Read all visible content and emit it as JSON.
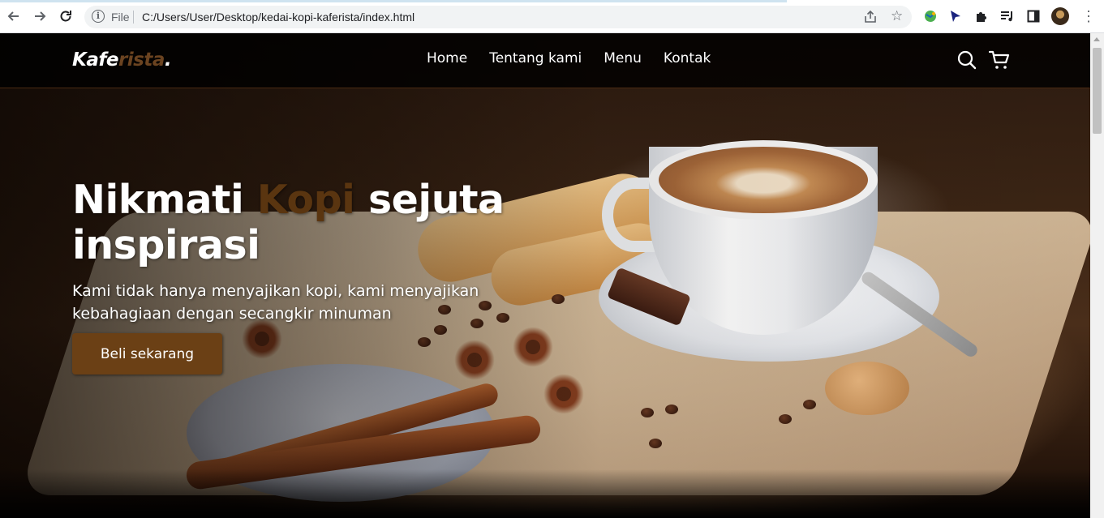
{
  "browser": {
    "file_label": "File",
    "url": "C:/Users/User/Desktop/kedai-kopi-kaferista/index.html",
    "icons": [
      "back-icon",
      "forward-icon",
      "reload-icon",
      "info-icon",
      "share-icon",
      "star-icon",
      "extension-icon",
      "puzzle-icon",
      "media-icon",
      "side-panel-icon",
      "profile-avatar",
      "menu-icon"
    ]
  },
  "site": {
    "logo": {
      "part1": "Kafe",
      "part2": "rista",
      "part3": "."
    },
    "nav": [
      {
        "label": "Home"
      },
      {
        "label": "Tentang kami"
      },
      {
        "label": "Menu"
      },
      {
        "label": "Kontak"
      }
    ],
    "icons": [
      "search-icon",
      "shopping-cart-icon"
    ]
  },
  "hero": {
    "title_part1": "Nikmati ",
    "title_accent": "Kopi",
    "title_part2": " sejuta inspirasi",
    "subtitle": "Kami tidak hanya menyajikan kopi, kami menyajikan kebahagiaan dengan secangkir minuman",
    "cta_label": "Beli sekarang"
  },
  "colors": {
    "accent": "#6b4015",
    "navbar_bg": "#000000",
    "text": "#ffffff"
  }
}
